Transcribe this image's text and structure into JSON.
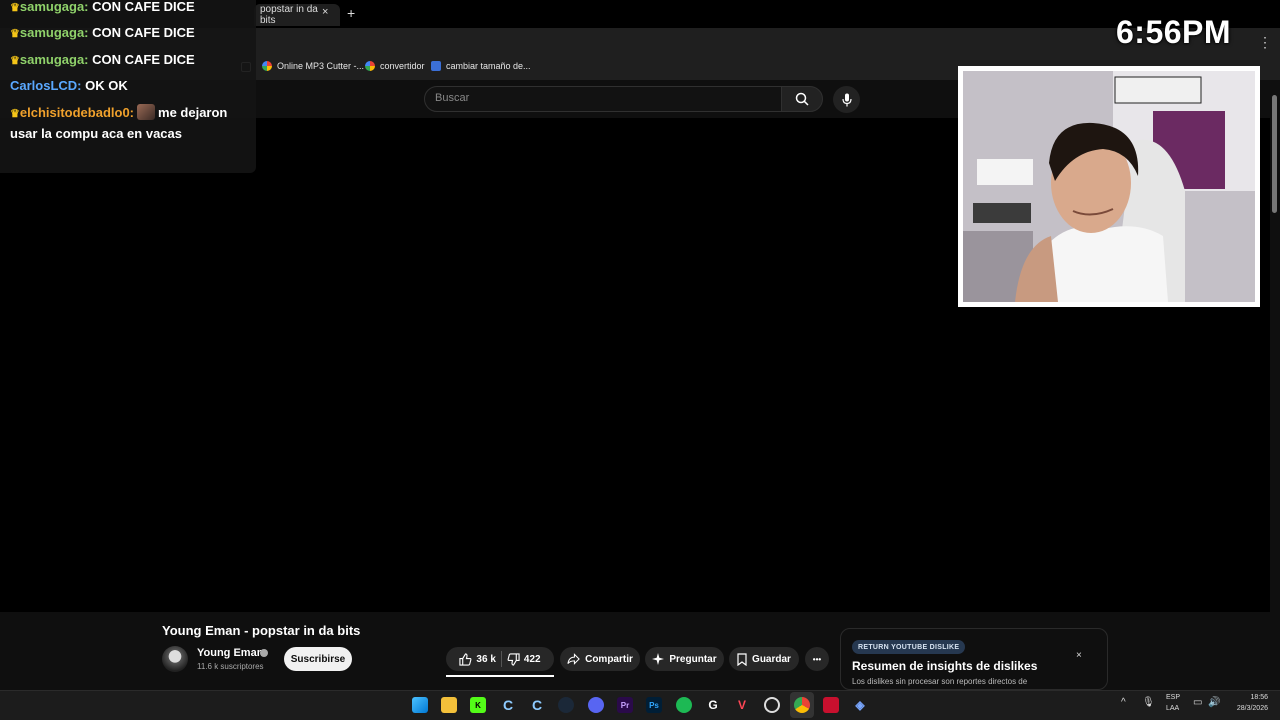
{
  "browser": {
    "active_tab_label": "popstar in da bits",
    "tab_close": "×",
    "new_tab": "+",
    "menu": "⋮",
    "bookmarks": [
      {
        "label": "Online MP3 Cutter -..."
      },
      {
        "label": "convertidor"
      },
      {
        "label": "cambiar tamaño de..."
      }
    ]
  },
  "youtube": {
    "search_placeholder": "Buscar",
    "video_title": "Young Eman - popstar in da bits",
    "channel_name": "Young Eman",
    "subscribers": "11.6 k suscriptores",
    "subscribe_label": "Suscribirse",
    "likes": "36 k",
    "dislikes": "422",
    "share_label": "Compartir",
    "ask_label": "Preguntar",
    "save_label": "Guardar",
    "more_label": "•••"
  },
  "extension_card": {
    "badge": "RETURN YOUTUBE DISLIKE",
    "title": "Resumen de insights de dislikes",
    "description": "Los dislikes sin procesar son reportes directos de",
    "close": "×"
  },
  "stream_overlay": {
    "clock": "6:56PM",
    "chat": [
      {
        "user": "samugaga:",
        "message": " CON CAFE DICE",
        "color": "#8fd16a"
      },
      {
        "user": "samugaga:",
        "message": " CON CAFE DICE",
        "color": "#8fd16a"
      },
      {
        "user": "samugaga:",
        "message": " CON CAFE DICE",
        "color": "#8fd16a"
      },
      {
        "user": "CarlosLCD:",
        "message": " OK OK",
        "color": "#5aa8ff"
      },
      {
        "user": "elchisitodebadlo0:",
        "message": "me dejaron usar la compu aca en vacas",
        "color": "#f0a12c"
      }
    ]
  },
  "taskbar": {
    "icons": [
      "windows-start",
      "file-explorer",
      "kick",
      "ccleaner",
      "ccleaner-2",
      "steam",
      "discord",
      "premiere",
      "photoshop",
      "spotify",
      "logitech",
      "valorant",
      "obs",
      "chrome",
      "streamlabs",
      "app"
    ],
    "lang_1": "ESP",
    "lang_2": "LAA",
    "time": "18:56",
    "date": "28/3/2026"
  }
}
